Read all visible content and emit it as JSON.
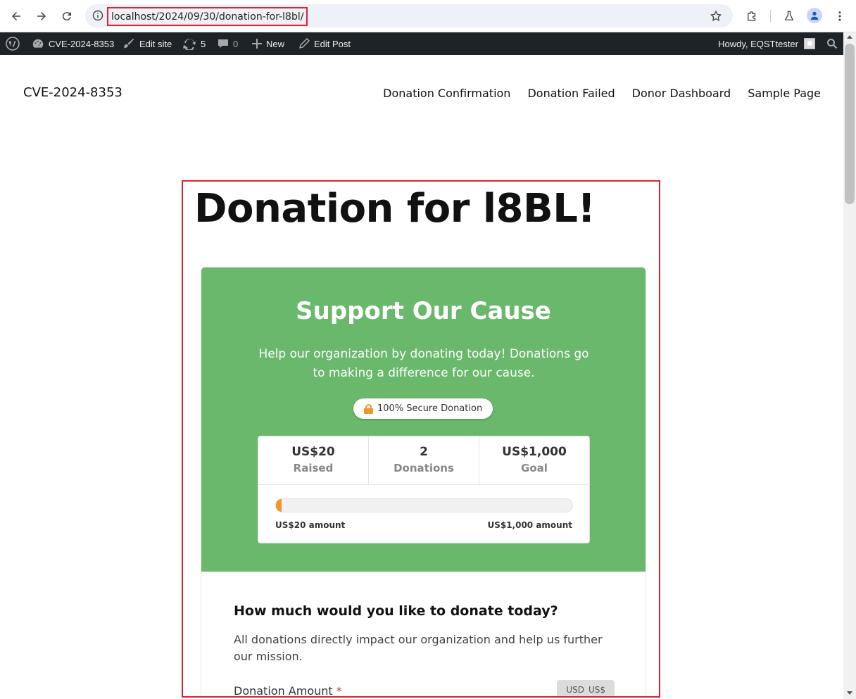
{
  "browser": {
    "url": "localhost/2024/09/30/donation-for-l8bl/"
  },
  "adminbar": {
    "site_name": "CVE-2024-8353",
    "edit_site": "Edit site",
    "updates_count": "5",
    "comments_count": "0",
    "new_label": "New",
    "edit_post": "Edit Post",
    "howdy": "Howdy, EQSTtester"
  },
  "site": {
    "title": "CVE-2024-8353",
    "nav": [
      "Donation Confirmation",
      "Donation Failed",
      "Donor Dashboard",
      "Sample Page"
    ]
  },
  "post": {
    "title": "Donation for l8BL!"
  },
  "form": {
    "hero_title": "Support Our Cause",
    "hero_description": "Help our organization by donating today! Donations go to making a difference for our cause.",
    "secure_badge": "100% Secure Donation",
    "stats": [
      {
        "value": "US$20",
        "label": "Raised"
      },
      {
        "value": "2",
        "label": "Donations"
      },
      {
        "value": "US$1,000",
        "label": "Goal"
      }
    ],
    "progress_fraction": 0.02,
    "progress_min_label": "US$20 amount",
    "progress_max_label": "US$1,000 amount",
    "question": "How much would you like to donate today?",
    "description": "All donations directly impact our organization and help us further our mission.",
    "amount_label": "Donation Amount",
    "required_mark": "*",
    "currency_code": "USD",
    "currency_symbol": "US$"
  },
  "colors": {
    "hero_green": "#69b86b",
    "accent_orange": "#f0962b",
    "highlight_red": "#e0202f",
    "adminbar_bg": "#1d2327"
  }
}
